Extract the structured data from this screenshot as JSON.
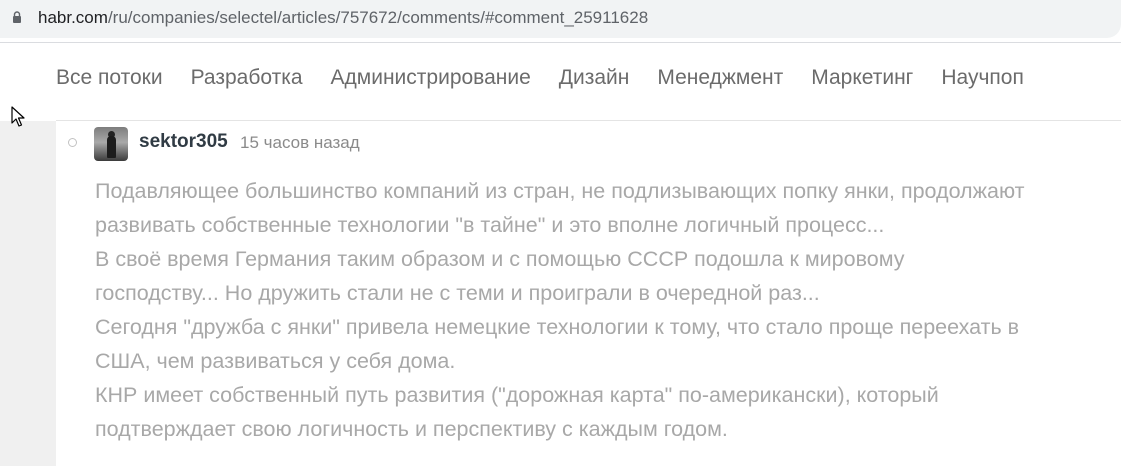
{
  "browser": {
    "url_host": "habr.com",
    "url_path": "/ru/companies/selectel/articles/757672/comments/#comment_25911628"
  },
  "nav": {
    "items": [
      {
        "label": "Все потоки"
      },
      {
        "label": "Разработка"
      },
      {
        "label": "Администрирование"
      },
      {
        "label": "Дизайн"
      },
      {
        "label": "Менеджмент"
      },
      {
        "label": "Маркетинг"
      },
      {
        "label": "Научпоп"
      }
    ]
  },
  "comment": {
    "username": "sektor305",
    "timestamp": "15 часов назад",
    "lines": [
      "Подавляющее большинство компаний из стран, не подлизывающих попку янки, продолжают",
      "развивать собственные технологии \"в тайне\" и это вполне логичный процесс...",
      "В своё время Германия таким образом и с помощью СССР подошла к мировому",
      "господству... Но дружить стали не с теми и проиграли в очередной раз...",
      "Сегодня \"дружба с янки\" привела немецкие технологии к тому, что стало проще переехать в",
      "США, чем развиваться у себя дома.",
      "КНР имеет собственный путь развития (\"дорожная карта\" по-американски), который",
      "подтверждает свою логичность и перспективу с каждым годом."
    ]
  },
  "colors": {
    "nav_text": "#6b6b6b",
    "comment_text": "#a8a8a8",
    "username": "#303b44"
  },
  "icons": [
    "lock-icon",
    "cursor-icon",
    "thread-marker-icon"
  ]
}
